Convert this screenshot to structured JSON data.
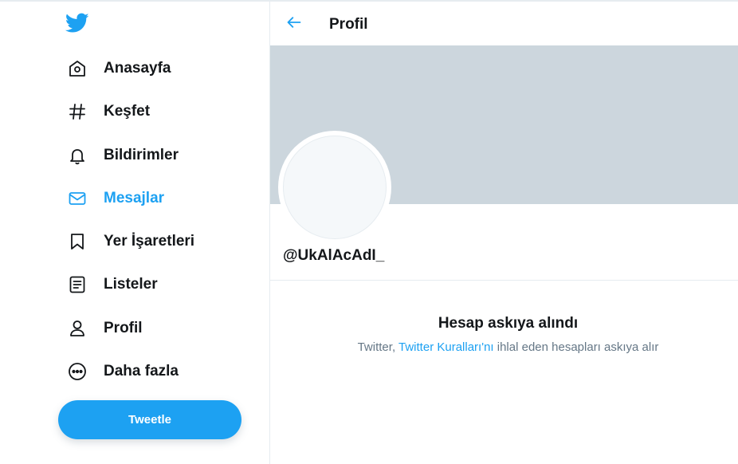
{
  "sidebar": {
    "logo_icon": "twitter-bird-icon",
    "items": [
      {
        "label": "Anasayfa",
        "icon": "home-icon"
      },
      {
        "label": "Keşfet",
        "icon": "hashtag-icon"
      },
      {
        "label": "Bildirimler",
        "icon": "bell-icon"
      },
      {
        "label": "Mesajlar",
        "icon": "envelope-icon",
        "active": true
      },
      {
        "label": "Yer İşaretleri",
        "icon": "bookmark-icon"
      },
      {
        "label": "Listeler",
        "icon": "list-icon"
      },
      {
        "label": "Profil",
        "icon": "person-icon"
      },
      {
        "label": "Daha fazla",
        "icon": "more-icon"
      }
    ],
    "tweet_button": "Tweetle"
  },
  "header": {
    "title": "Profil",
    "back_icon": "arrow-left-icon"
  },
  "profile": {
    "handle": "@UkAlAcAdI_"
  },
  "suspended": {
    "title": "Hesap askıya alındı",
    "text_before": "Twitter, ",
    "link": "Twitter Kuralları'nı",
    "text_after": " ihlal eden hesapları askıya alır"
  },
  "colors": {
    "accent": "#1da1f2",
    "banner": "#ccd6dd",
    "text": "#14171a",
    "secondary_text": "#657786"
  }
}
